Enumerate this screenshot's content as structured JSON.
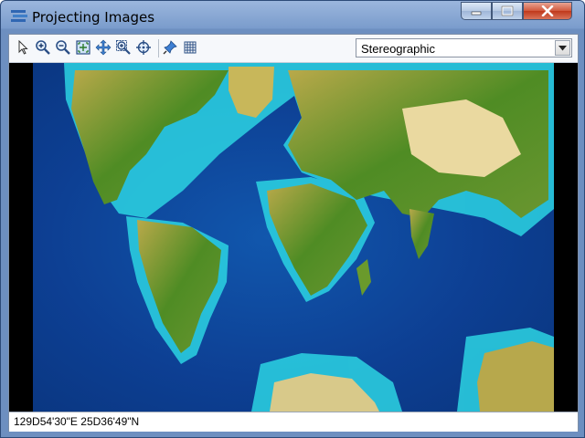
{
  "window": {
    "title": "Projecting Images"
  },
  "toolbar": {
    "tools": [
      "select-arrow-icon",
      "zoom-in-icon",
      "zoom-out-icon",
      "zoom-extent-icon",
      "pan-icon",
      "zoom-box-icon",
      "center-icon",
      "pin-icon",
      "grid-icon"
    ],
    "projection_selected": "Stereographic"
  },
  "status": {
    "coordinates": "129D54'30\"E 25D36'49\"N"
  },
  "colors": {
    "ocean_deep": "#0a3d8f",
    "ocean_shallow": "#2aa6d8",
    "coast": "#33e0e6",
    "land_low": "#3a8a1e",
    "land_high": "#c8b75a"
  }
}
